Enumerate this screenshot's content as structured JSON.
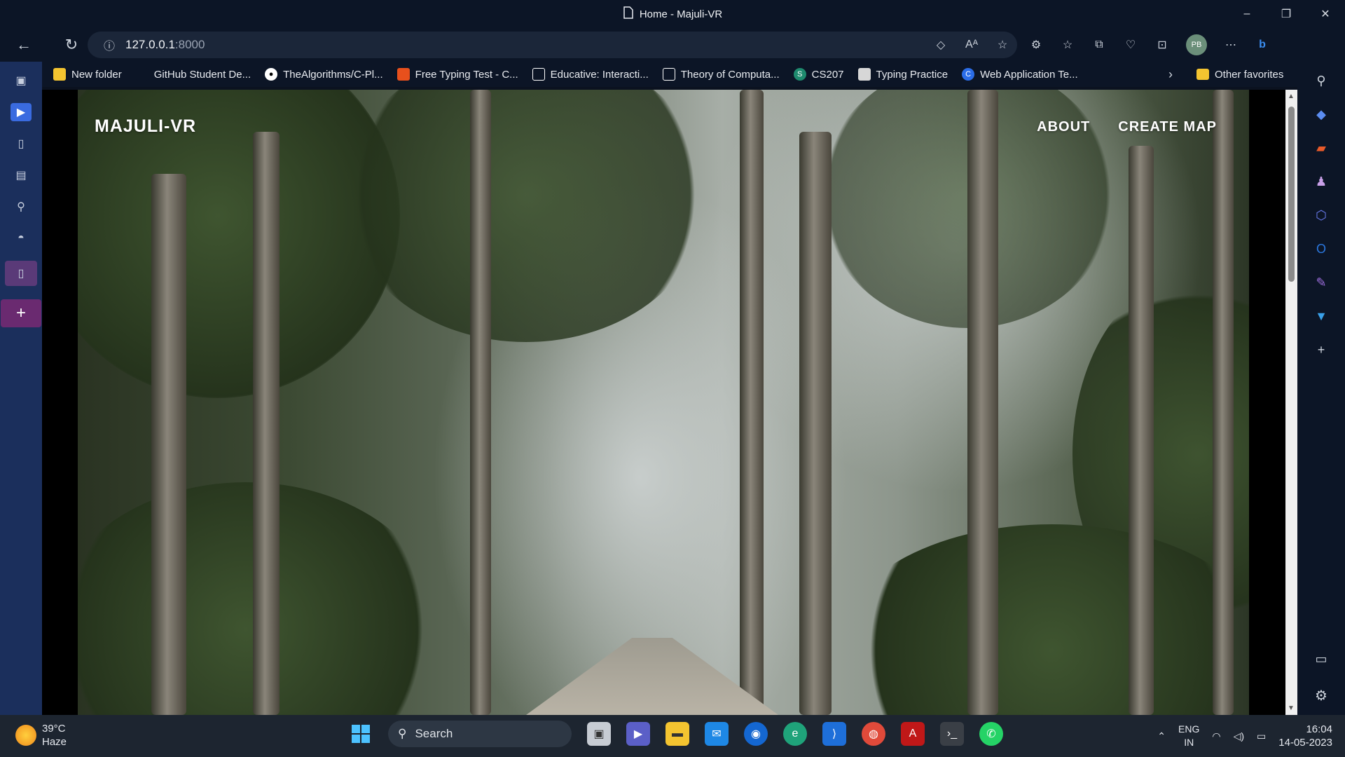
{
  "window": {
    "title": "Home - Majuli-VR",
    "controls": [
      "minimize-icon",
      "restore-icon",
      "close-icon"
    ]
  },
  "addressbar": {
    "url_host": "127.0.0.1",
    "url_port": ":8000"
  },
  "favorites": {
    "items": [
      {
        "label": "New folder",
        "icon": "folder-icon",
        "color": "#f4c430"
      },
      {
        "label": "GitHub Student De...",
        "icon": "github-student-icon",
        "color": "#0c1526"
      },
      {
        "label": "TheAlgorithms/C-Pl...",
        "icon": "github-icon",
        "color": "#ffffff"
      },
      {
        "label": "Free Typing Test - C...",
        "icon": "typing-test-icon",
        "color": "#e8501c"
      },
      {
        "label": "Educative: Interacti...",
        "icon": "educative-icon",
        "color": "#ffffff"
      },
      {
        "label": "Theory of Computa...",
        "icon": "page-icon",
        "color": "#ffffff"
      },
      {
        "label": "CS207",
        "icon": "sharepoint-icon",
        "color": "#1e8a6e"
      },
      {
        "label": "Typing Practice",
        "icon": "typing-practice-icon",
        "color": "#d7d7d7"
      },
      {
        "label": "Web Application Te...",
        "icon": "c-icon",
        "color": "#2b6de8"
      }
    ],
    "other": "Other favorites"
  },
  "profile": {
    "initials": "PB"
  },
  "site": {
    "logo": "MAJULI-VR",
    "nav": [
      "ABOUT",
      "CREATE MAP"
    ]
  },
  "taskbar": {
    "weather": {
      "temp": "39°C",
      "condition": "Haze"
    },
    "search_label": "Search",
    "language": {
      "line1": "ENG",
      "line2": "IN"
    },
    "time": "16:04",
    "date": "14-05-2023"
  }
}
